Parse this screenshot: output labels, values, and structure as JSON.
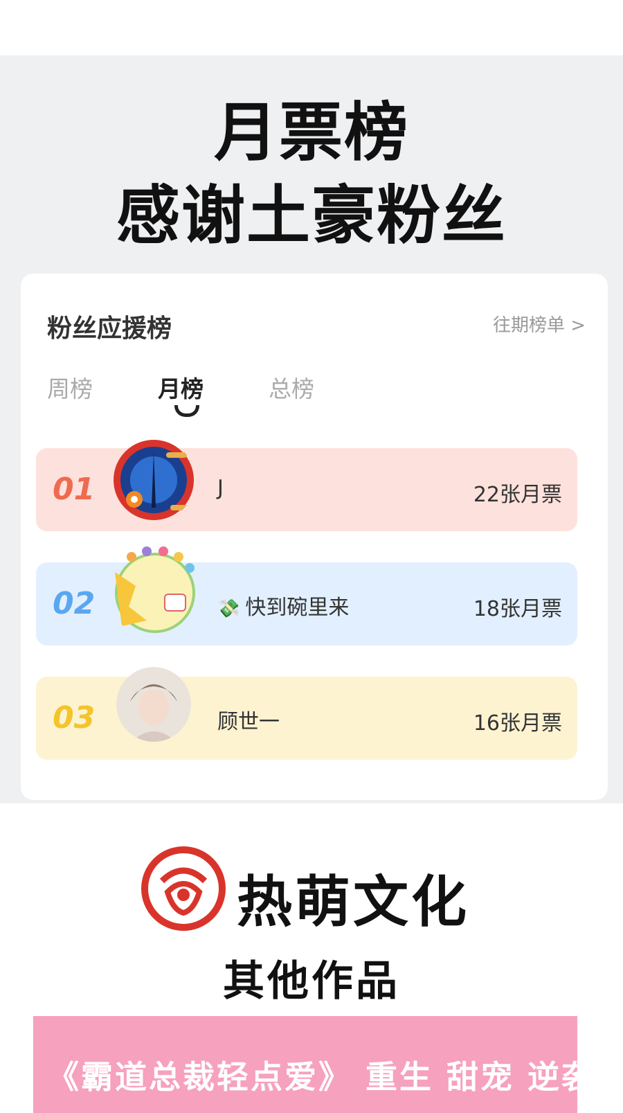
{
  "header": {
    "line1": "月票榜",
    "line2": "感谢土豪粉丝"
  },
  "card": {
    "title": "粉丝应援榜",
    "history_link": "往期榜单 >",
    "tabs": [
      {
        "label": "周榜",
        "active": false
      },
      {
        "label": "月榜",
        "active": true
      },
      {
        "label": "总榜",
        "active": false
      }
    ],
    "rankings": [
      {
        "rank": "01",
        "name": "J",
        "votes": "22张月票",
        "row_color": "#fde1dc",
        "num_color": "#ef6b4f"
      },
      {
        "rank": "02",
        "name": "快到碗里来",
        "votes": "18张月票",
        "row_color": "#e2efff",
        "num_color": "#5aa7f0",
        "badge_icon": "money-icon"
      },
      {
        "rank": "03",
        "name": "顾世一",
        "votes": "16张月票",
        "row_color": "#fdf3d1",
        "num_color": "#f4c42a"
      }
    ]
  },
  "brand": {
    "name": "热萌文化",
    "other_works": "其他作品",
    "logo_color": "#d9342b"
  },
  "promo": {
    "text": "《霸道总裁轻点爱》 重生 甜宠 逆袭",
    "bg_color": "#f6a1bd"
  }
}
